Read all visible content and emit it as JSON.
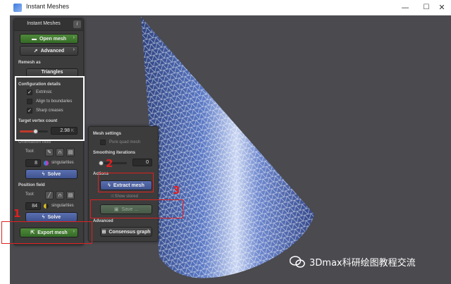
{
  "window": {
    "title": "Instant Meshes",
    "minimize": "—",
    "maximize": "☐",
    "close": "✕"
  },
  "panel": {
    "title": "Instant Meshes",
    "info": "i",
    "open_mesh": "Open mesh",
    "advanced": "Advanced",
    "remesh_as_label": "Remesh as",
    "remesh_as_value": "Triangles",
    "config_details_label": "Configuration details",
    "extrinsic": {
      "label": "Extrinsic",
      "checked": true
    },
    "align_boundaries": {
      "label": "Align to boundaries",
      "checked": false
    },
    "sharp_creases": {
      "label": "Sharp creases",
      "checked": true
    },
    "target_vertex_label": "Target vertex count",
    "target_vertex_value": "2.98",
    "target_vertex_unit": "K",
    "orientation_field_label": "Orientation field",
    "orient_tool_label": "Tool:",
    "orient_singularities_count": "8",
    "orient_singularities_label": "singularities",
    "orient_solve": "Solve",
    "position_field_label": "Position field",
    "pos_tool_label": "Tool:",
    "pos_singularities_count": "84",
    "pos_singularities_label": "singularities",
    "pos_solve": "Solve",
    "export_mesh": "Export mesh"
  },
  "export_panel": {
    "mesh_settings_label": "Mesh settings",
    "pure_quad_label": "Pure quad mesh",
    "smoothing_label": "Smoothing iterations",
    "smoothing_value": "0",
    "actions_label": "Actions",
    "extract_mesh": "Extract mesh",
    "show_stored": "Show stored",
    "save": "Save ...",
    "advanced_label": "Advanced",
    "consensus_graph": "Consensus graph"
  },
  "annotations": {
    "n1": "1",
    "n2": "2",
    "n3": "3"
  },
  "watermark": {
    "text": "3Dmax科研绘图教程交流"
  },
  "colors": {
    "background": "#4a4a4f",
    "mesh": "#4f6fb8",
    "annotation": "#e02020",
    "green": "#3f7a30",
    "blue": "#4b5f9f"
  },
  "icons": [
    "app-icon",
    "folder-icon",
    "rocket-icon",
    "bolt-icon",
    "export-icon",
    "save-icon",
    "graph-icon",
    "shuffle-icon",
    "brush-icon",
    "wechat-icon"
  ]
}
